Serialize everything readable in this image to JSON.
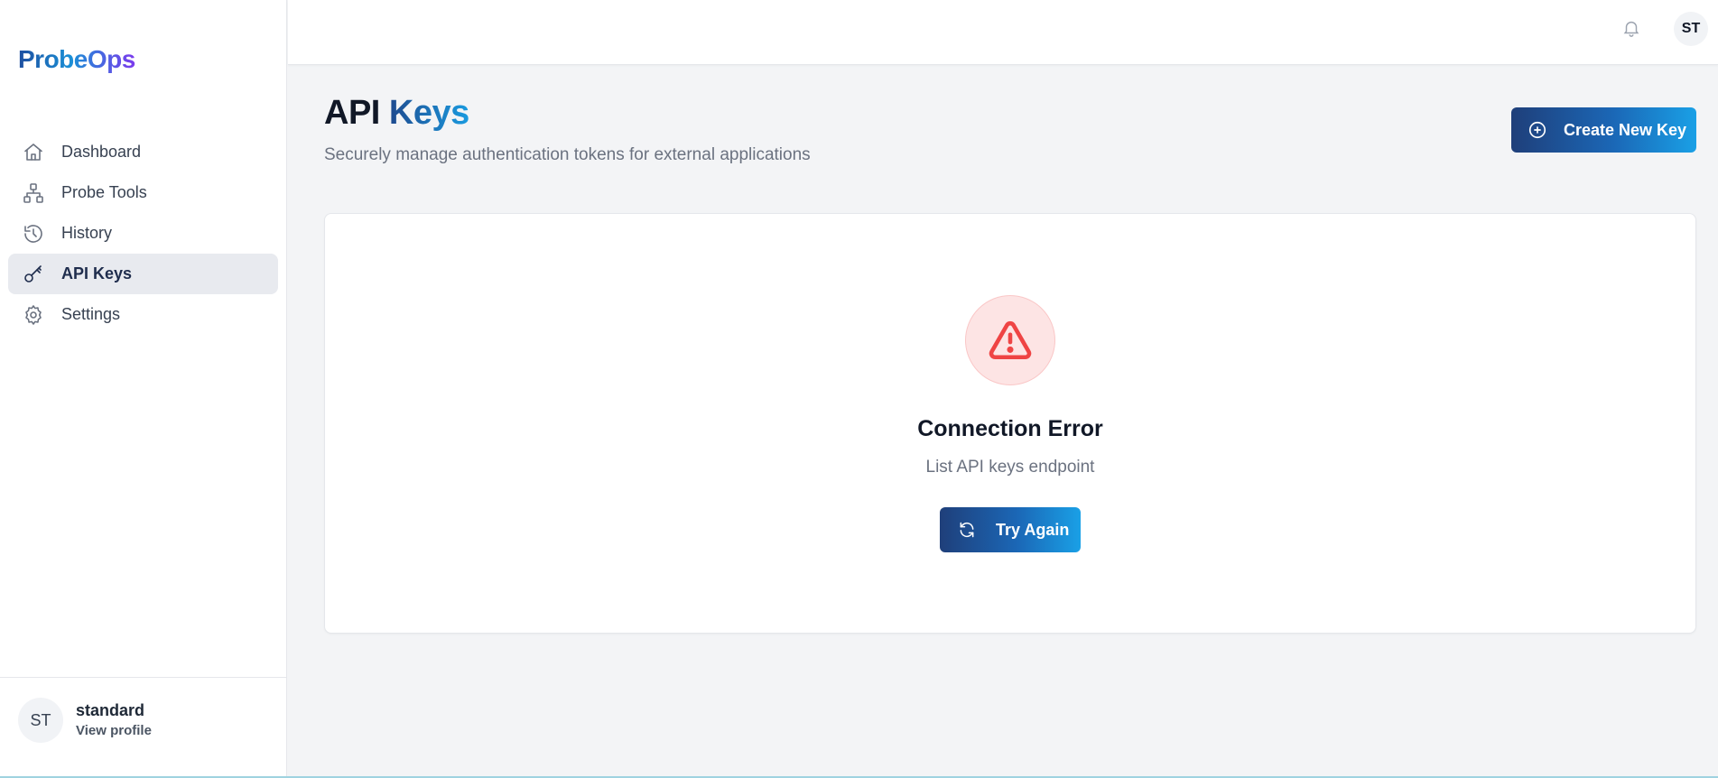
{
  "brand": {
    "name": "ProbeOps"
  },
  "sidebar": {
    "items": [
      {
        "label": "Dashboard",
        "icon": "home-icon",
        "active": false
      },
      {
        "label": "Probe Tools",
        "icon": "network-icon",
        "active": false
      },
      {
        "label": "History",
        "icon": "history-icon",
        "active": false
      },
      {
        "label": "API Keys",
        "icon": "key-icon",
        "active": true
      },
      {
        "label": "Settings",
        "icon": "gear-icon",
        "active": false
      }
    ],
    "user": {
      "initials": "ST",
      "name": "standard",
      "link": "View profile"
    }
  },
  "topbar": {
    "notification_icon": "bell-icon",
    "avatar_initials": "ST"
  },
  "header": {
    "title_part1": "API",
    "title_part2": "Keys",
    "subtitle": "Securely manage authentication tokens for external applications",
    "create_button": "Create New Key"
  },
  "error": {
    "icon": "warning-triangle-icon",
    "title": "Connection Error",
    "message": "List API keys endpoint",
    "retry_button": "Try Again"
  },
  "colors": {
    "accent_start": "#1f3f7a",
    "accent_end": "#1aa0e6",
    "error": "#ef4444",
    "page_bg": "#f3f4f6"
  }
}
